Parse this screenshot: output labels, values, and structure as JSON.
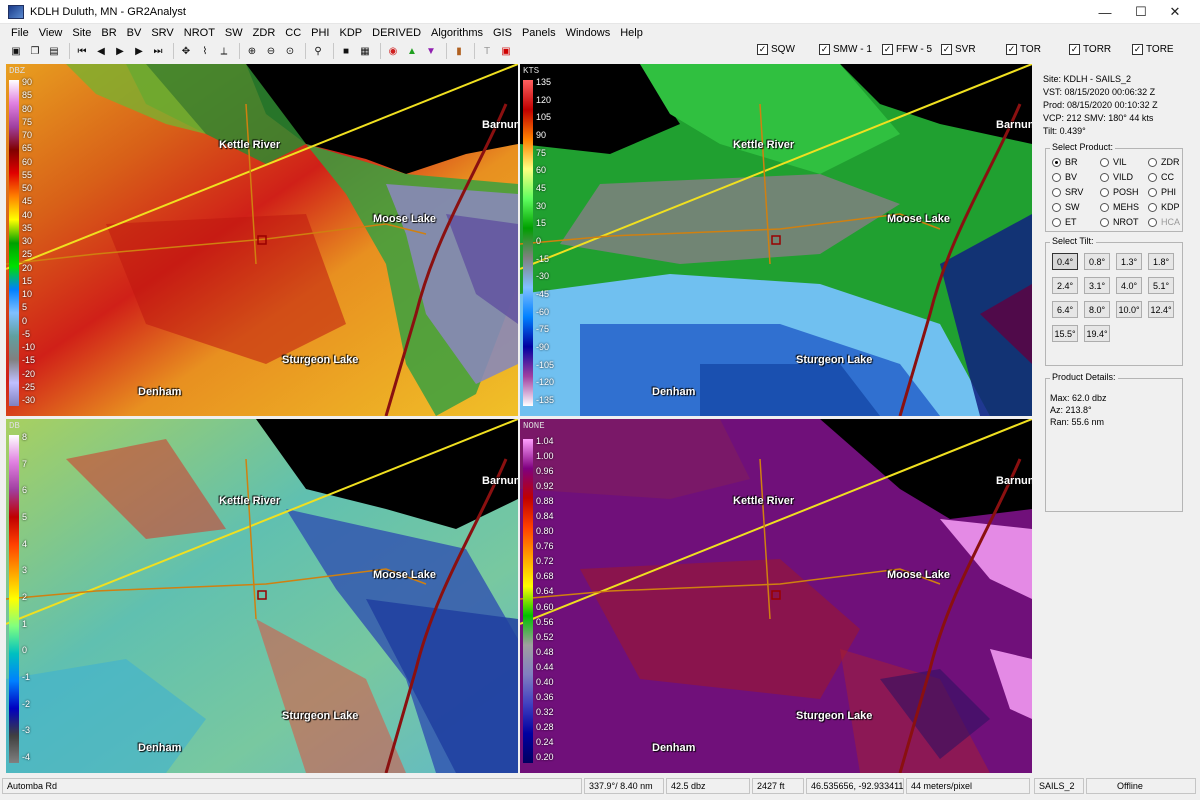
{
  "window": {
    "title": "KDLH Duluth, MN - GR2Analyst",
    "controls": {
      "minimize": "—",
      "maximize": "☐",
      "close": "✕"
    }
  },
  "menu": [
    "File",
    "View",
    "Site",
    "BR",
    "BV",
    "SRV",
    "NROT",
    "SW",
    "ZDR",
    "CC",
    "PHI",
    "KDP",
    "DERIVED",
    "Algorithms",
    "GIS",
    "Panels",
    "Windows",
    "Help"
  ],
  "warnings": [
    {
      "label": "SQW",
      "checked": true
    },
    {
      "label": "SMW - 1",
      "checked": true
    },
    {
      "label": "FFW - 5",
      "checked": true
    },
    {
      "label": "SVR",
      "checked": true
    },
    {
      "label": "TOR",
      "checked": true
    },
    {
      "label": "TORR",
      "checked": true
    },
    {
      "label": "TORE",
      "checked": true
    }
  ],
  "panels": {
    "reflectivity": {
      "unit": "DBZ",
      "scale": [
        "90",
        "85",
        "80",
        "75",
        "70",
        "65",
        "60",
        "55",
        "50",
        "45",
        "40",
        "35",
        "30",
        "25",
        "20",
        "15",
        "10",
        "5",
        "0",
        "-5",
        "-10",
        "-15",
        "-20",
        "-25",
        "-30"
      ]
    },
    "velocity": {
      "unit": "KTS",
      "scale": [
        "135",
        "120",
        "105",
        "90",
        "75",
        "60",
        "45",
        "30",
        "15",
        "0",
        "-15",
        "-30",
        "-45",
        "-60",
        "-75",
        "-90",
        "-105",
        "-120",
        "-135"
      ]
    },
    "zdr": {
      "unit": "DB",
      "scale": [
        "8",
        "7",
        "6",
        "5",
        "4",
        "3",
        "2",
        "1",
        "0",
        "-1",
        "-2",
        "-3",
        "-4"
      ]
    },
    "cc": {
      "unit": "NONE",
      "scale": [
        "1.04",
        "1.00",
        "0.96",
        "0.92",
        "0.88",
        "0.84",
        "0.80",
        "0.76",
        "0.72",
        "0.68",
        "0.64",
        "0.60",
        "0.56",
        "0.52",
        "0.48",
        "0.44",
        "0.40",
        "0.36",
        "0.32",
        "0.28",
        "0.24",
        "0.20"
      ]
    },
    "cities": {
      "kettle_river": "Kettle River",
      "moose_lake": "Moose Lake",
      "sturgeon_lake": "Sturgeon Lake",
      "denham": "Denham",
      "barnum": "Barnum"
    }
  },
  "info": {
    "site": "Site:   KDLH - SAILS_2",
    "vst": "VST:   08/15/2020  00:06:32 Z",
    "prod": "Prod:  08/15/2020  00:10:32 Z",
    "vcp": "VCP:   212          SMV:  180° 44 kts",
    "tilt": "Tilt:   0.439°"
  },
  "select_product": {
    "title": "Select Product:",
    "options": [
      {
        "label": "BR",
        "selected": true,
        "enabled": true
      },
      {
        "label": "VIL",
        "selected": false,
        "enabled": true
      },
      {
        "label": "ZDR",
        "selected": false,
        "enabled": true
      },
      {
        "label": "BV",
        "selected": false,
        "enabled": true
      },
      {
        "label": "VILD",
        "selected": false,
        "enabled": true
      },
      {
        "label": "CC",
        "selected": false,
        "enabled": true
      },
      {
        "label": "SRV",
        "selected": false,
        "enabled": true
      },
      {
        "label": "POSH",
        "selected": false,
        "enabled": true
      },
      {
        "label": "PHI",
        "selected": false,
        "enabled": true
      },
      {
        "label": "SW",
        "selected": false,
        "enabled": true
      },
      {
        "label": "MEHS",
        "selected": false,
        "enabled": true
      },
      {
        "label": "KDP",
        "selected": false,
        "enabled": true
      },
      {
        "label": "ET",
        "selected": false,
        "enabled": true
      },
      {
        "label": "NROT",
        "selected": false,
        "enabled": true
      },
      {
        "label": "HCA",
        "selected": false,
        "enabled": false
      }
    ]
  },
  "select_tilt": {
    "title": "Select Tilt:",
    "options": [
      "0.4°",
      "0.8°",
      "1.3°",
      "1.8°",
      "2.4°",
      "3.1°",
      "4.0°",
      "5.1°",
      "6.4°",
      "8.0°",
      "10.0°",
      "12.4°",
      "15.5°",
      "19.4°"
    ],
    "selected": "0.4°"
  },
  "product_details": {
    "title": "Product Details:",
    "max": "Max:  62.0 dbz",
    "az": "Az:   213.8°",
    "ran": "Ran:  55.6 nm"
  },
  "status": {
    "location": "Automba Rd",
    "azran": "337.9°/ 8.40 nm",
    "value": "42.5 dbz",
    "height": "2427 ft",
    "latlon": "46.535656, -92.933411",
    "resolution": "44 meters/pixel",
    "mode": "SAILS_2",
    "connection": "Offline"
  }
}
